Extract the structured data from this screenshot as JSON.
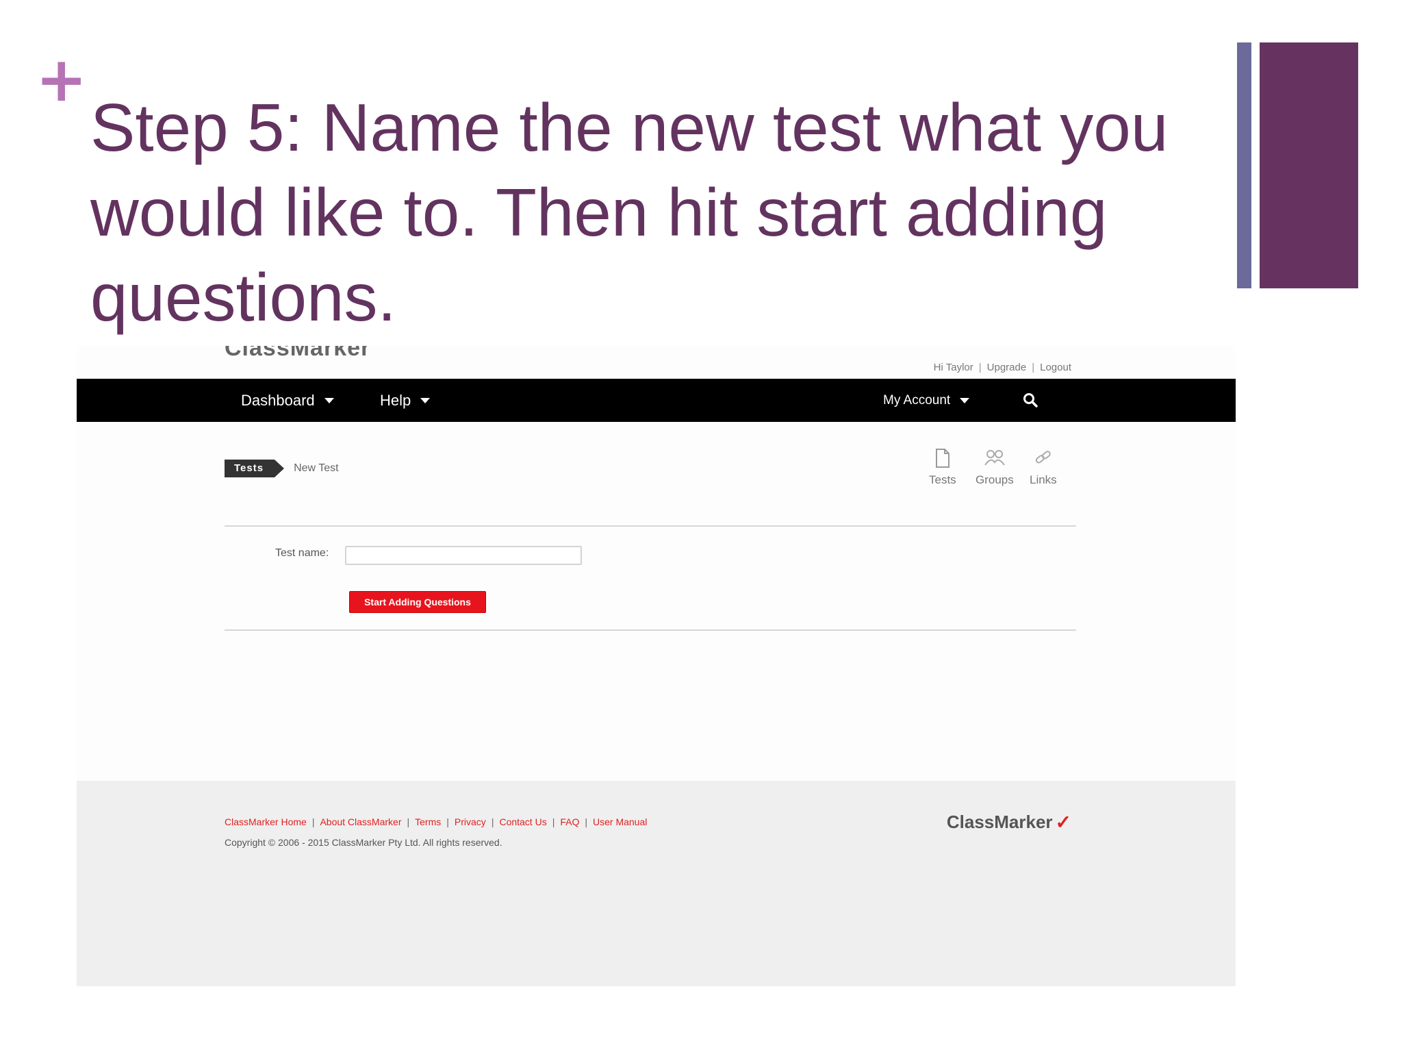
{
  "slide": {
    "bullet": "+",
    "title": "Step 5: Name the new test what you would like to. Then hit start adding questions.",
    "colors": {
      "title": "#633360",
      "bullet": "#b573b6",
      "accent_bar": "#663361",
      "accent_bar_thin": "#6b6a9a"
    }
  },
  "app": {
    "logo_partial": "ClassMarker",
    "user_links": [
      "Hi Taylor",
      "Upgrade",
      "Logout"
    ],
    "nav": {
      "dashboard": "Dashboard",
      "help": "Help",
      "account": "My Account"
    },
    "breadcrumb": {
      "parent": "Tests",
      "current": "New Test"
    },
    "quick_links": [
      {
        "label": "Tests",
        "icon": "document-icon"
      },
      {
        "label": "Groups",
        "icon": "groups-icon"
      },
      {
        "label": "Links",
        "icon": "link-icon"
      }
    ],
    "form": {
      "test_name_label": "Test name:",
      "test_name_value": "",
      "submit_label": "Start Adding Questions"
    },
    "footer": {
      "links": [
        "ClassMarker Home",
        "About ClassMarker",
        "Terms",
        "Privacy",
        "Contact Us",
        "FAQ",
        "User Manual"
      ],
      "copyright": "Copyright © 2006 - 2015 ClassMarker Pty Ltd. All rights reserved.",
      "logo": "ClassMarker"
    },
    "colors": {
      "navbar": "#000000",
      "button": "#e8141d",
      "footer_link": "#e02020",
      "footer_bg": "#efefef"
    }
  }
}
